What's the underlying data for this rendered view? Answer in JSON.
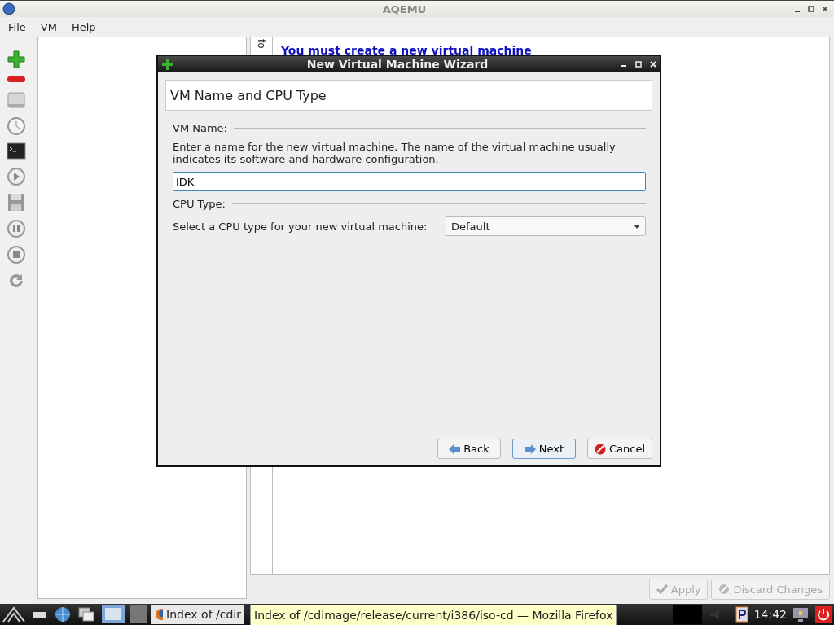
{
  "window": {
    "title": "AQEMU"
  },
  "menu": [
    {
      "label": "File"
    },
    {
      "label": "VM"
    },
    {
      "label": "Help"
    }
  ],
  "info_tab": {
    "label": "fo"
  },
  "info_panel": {
    "message": "You must create a new virtual machine"
  },
  "bottom_buttons": [
    {
      "label": "Apply",
      "kind": "apply",
      "disabled": true
    },
    {
      "label": "Discard Changes",
      "kind": "discard",
      "disabled": true
    }
  ],
  "dialog": {
    "title": "New Virtual Machine Wizard",
    "page_title": "VM Name and CPU Type",
    "vm_name_heading": "VM Name:",
    "vm_name_hint": "Enter a name for the new virtual machine. The name of the virtual machine usually indicates its software and hardware configuration.",
    "vm_name_value": "IDK",
    "cpu_heading": "CPU Type:",
    "cpu_label": "Select a CPU type for your new virtual machine:",
    "cpu_value": "Default",
    "buttons": [
      {
        "label": "Back",
        "kind": "back"
      },
      {
        "label": "Next",
        "kind": "next"
      },
      {
        "label": "Cancel",
        "kind": "cancel"
      }
    ]
  },
  "taskbar": {
    "tasks": [
      {
        "label": "Index of /cdir"
      }
    ],
    "tooltip": "Index of /cdimage/release/current/i386/iso-cd — Mozilla Firefox",
    "clock": "14:42"
  }
}
